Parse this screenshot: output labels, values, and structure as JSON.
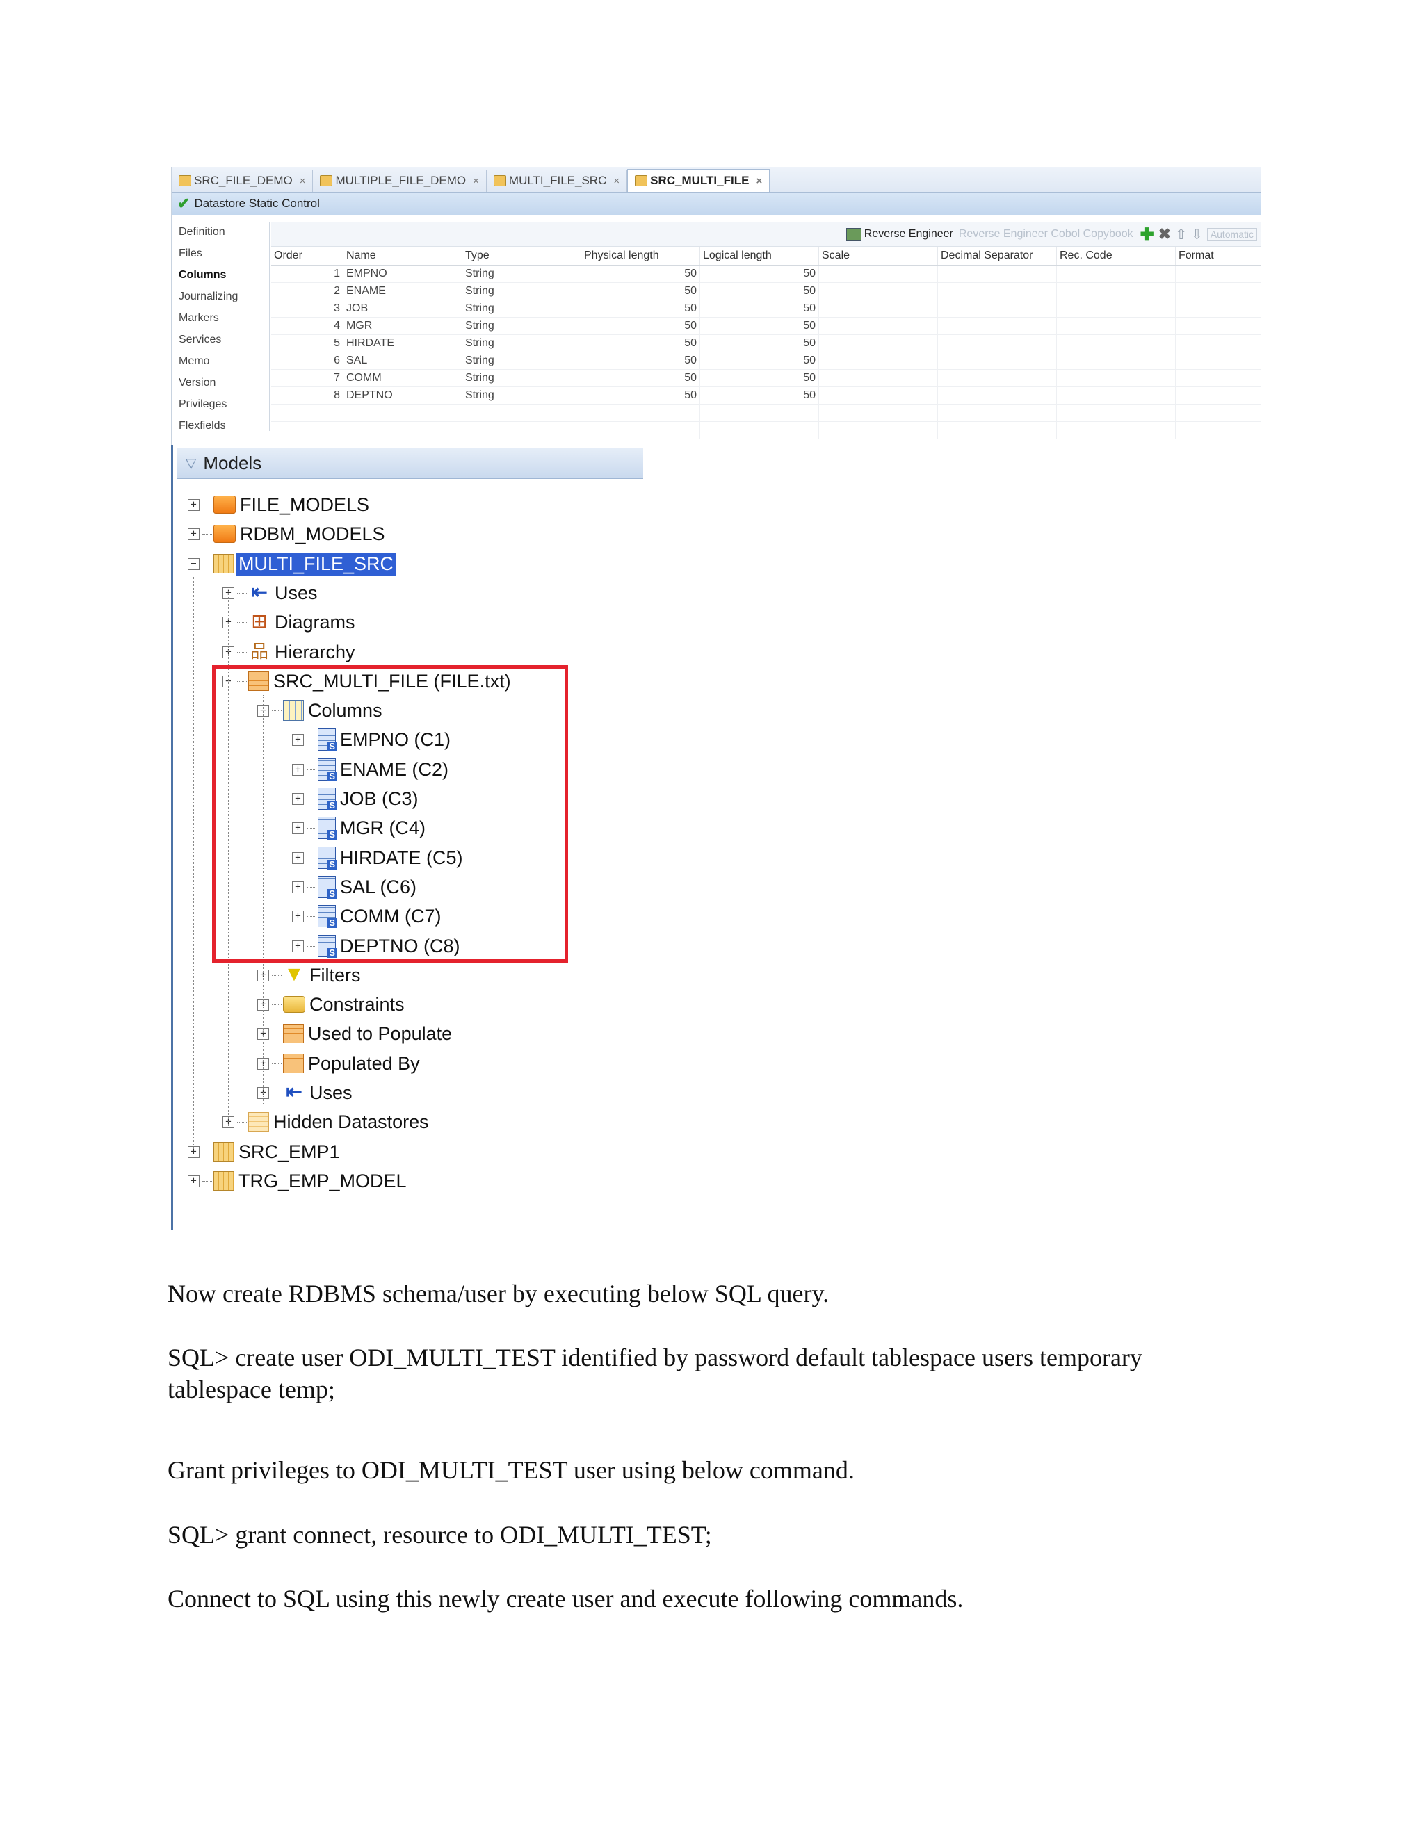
{
  "editor": {
    "tabs": [
      {
        "label": "SRC_FILE_DEMO",
        "active": false
      },
      {
        "label": "MULTIPLE_FILE_DEMO",
        "active": false
      },
      {
        "label": "MULTI_FILE_SRC",
        "active": false
      },
      {
        "label": "SRC_MULTI_FILE",
        "active": true
      }
    ],
    "status": "Datastore Static Control",
    "side_menu": [
      "Definition",
      "Files",
      "Columns",
      "Journalizing",
      "Markers",
      "Services",
      "Memo",
      "Version",
      "Privileges",
      "Flexfields"
    ],
    "side_menu_selected": "Columns",
    "toolbar": {
      "reverse_engineer": "Reverse Engineer",
      "reverse_engineer_cobol": "Reverse Engineer Cobol Copybook",
      "automatic": "Automatic"
    },
    "columns_header": [
      "Order",
      "Name",
      "Type",
      "Physical length",
      "Logical length",
      "Scale",
      "Decimal Separator",
      "Rec. Code",
      "Format"
    ],
    "rows": [
      {
        "order": "1",
        "name": "EMPNO",
        "type": "String",
        "physical": "50",
        "logical": "50"
      },
      {
        "order": "2",
        "name": "ENAME",
        "type": "String",
        "physical": "50",
        "logical": "50"
      },
      {
        "order": "3",
        "name": "JOB",
        "type": "String",
        "physical": "50",
        "logical": "50"
      },
      {
        "order": "4",
        "name": "MGR",
        "type": "String",
        "physical": "50",
        "logical": "50"
      },
      {
        "order": "5",
        "name": "HIRDATE",
        "type": "String",
        "physical": "50",
        "logical": "50"
      },
      {
        "order": "6",
        "name": "SAL",
        "type": "String",
        "physical": "50",
        "logical": "50"
      },
      {
        "order": "7",
        "name": "COMM",
        "type": "String",
        "physical": "50",
        "logical": "50"
      },
      {
        "order": "8",
        "name": "DEPTNO",
        "type": "String",
        "physical": "50",
        "logical": "50"
      }
    ]
  },
  "models": {
    "title": "Models",
    "items": [
      {
        "label": "FILE_MODELS",
        "icon": "folder-icon",
        "expander": "+"
      },
      {
        "label": "RDBM_MODELS",
        "icon": "folder-icon",
        "expander": "+"
      },
      {
        "label": "MULTI_FILE_SRC",
        "icon": "model-icon",
        "expander": "−",
        "selected": true
      },
      {
        "label": "Uses",
        "icon": "uses-icon",
        "expander": "+"
      },
      {
        "label": "Diagrams",
        "icon": "diagram-icon",
        "expander": "+"
      },
      {
        "label": "Hierarchy",
        "icon": "hierarchy-icon",
        "expander": "+"
      },
      {
        "label": "SRC_MULTI_FILE (FILE.txt)",
        "icon": "datastore-icon",
        "expander": "−"
      },
      {
        "label": "Columns",
        "icon": "columns-icon",
        "expander": "−"
      },
      {
        "label": "EMPNO (C1)",
        "icon": "column-icon",
        "expander": "+"
      },
      {
        "label": "ENAME (C2)",
        "icon": "column-icon",
        "expander": "+"
      },
      {
        "label": "JOB (C3)",
        "icon": "column-icon",
        "expander": "+"
      },
      {
        "label": "MGR (C4)",
        "icon": "column-icon",
        "expander": "+"
      },
      {
        "label": "HIRDATE (C5)",
        "icon": "column-icon",
        "expander": "+"
      },
      {
        "label": "SAL (C6)",
        "icon": "column-icon",
        "expander": "+"
      },
      {
        "label": "COMM (C7)",
        "icon": "column-icon",
        "expander": "+"
      },
      {
        "label": "DEPTNO (C8)",
        "icon": "column-icon",
        "expander": "+"
      },
      {
        "label": "Filters",
        "icon": "filter-icon",
        "expander": "+"
      },
      {
        "label": "Constraints",
        "icon": "constraints-icon",
        "expander": "+"
      },
      {
        "label": "Used to Populate",
        "icon": "datastore-icon",
        "expander": "+"
      },
      {
        "label": "Populated By",
        "icon": "datastore-icon",
        "expander": "+"
      },
      {
        "label": "Uses",
        "icon": "uses-icon",
        "expander": "+"
      },
      {
        "label": "Hidden Datastores",
        "icon": "hidden-datastore-icon",
        "expander": "+"
      },
      {
        "label": "SRC_EMP1",
        "icon": "model-icon",
        "expander": "+"
      },
      {
        "label": "TRG_EMP_MODEL",
        "icon": "model-icon",
        "expander": "+"
      }
    ]
  },
  "text": {
    "p1": "Now create RDBMS schema/user by executing below SQL query.",
    "p2": "SQL>  create user ODI_MULTI_TEST identified by password default tablespace users temporary tablespace temp;",
    "p3": "Grant privileges to ODI_MULTI_TEST user using below command.",
    "p4": "SQL> grant connect, resource to ODI_MULTI_TEST;",
    "p5": "Connect to SQL using this newly create user and execute following commands."
  },
  "colors": {
    "highlight_box": "#e4222d",
    "selection": "#2f5fd4"
  }
}
